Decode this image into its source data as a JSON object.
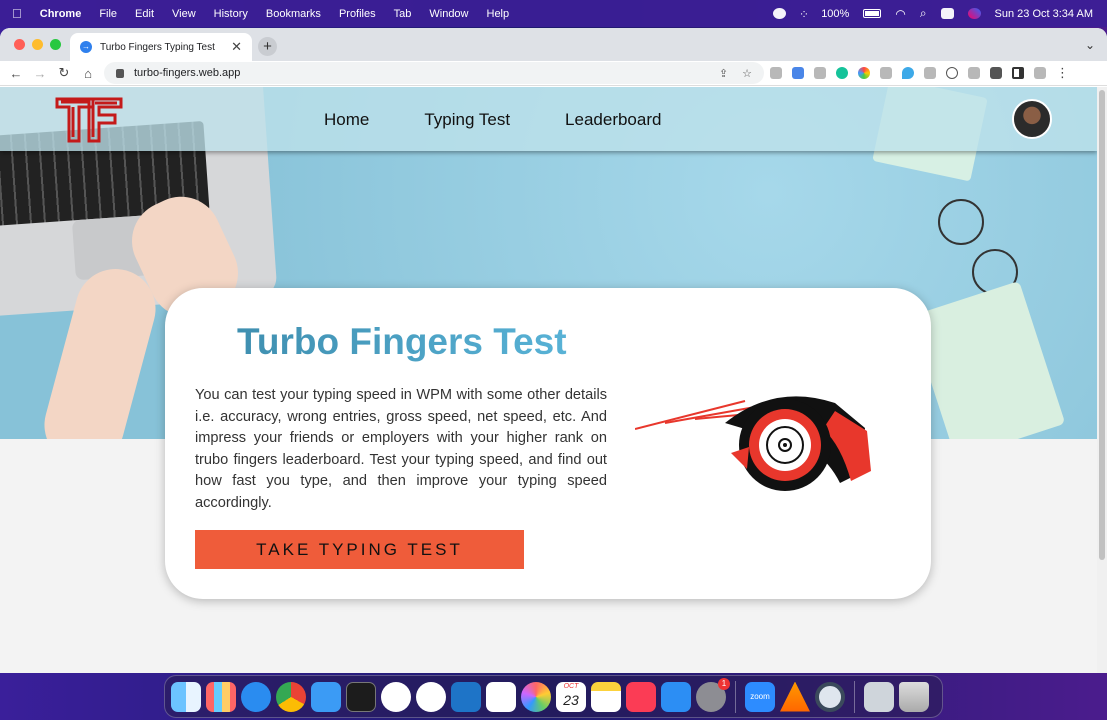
{
  "menubar": {
    "app_name": "Chrome",
    "menus": [
      "File",
      "Edit",
      "View",
      "History",
      "Bookmarks",
      "Profiles",
      "Tab",
      "Window",
      "Help"
    ],
    "battery": "100%",
    "clock": "Sun 23 Oct  3:34 AM"
  },
  "browser": {
    "tab_title": "Turbo Fingers Typing Test",
    "url": "turbo-fingers.web.app"
  },
  "site": {
    "nav": [
      "Home",
      "Typing Test",
      "Leaderboard"
    ],
    "hero_title": "Turbo Fingers Test",
    "description": "You can test your typing speed in WPM with some other details i.e. accuracy, wrong entries, gross speed, net speed, etc. And impress your friends or employers with your higher rank on trubo fingers leaderboard. Test your typing speed, and find out how fast you type, and then improve your typing speed accordingly.",
    "cta_label": "TAKE TYPING TEST",
    "colors": {
      "cta": "#ef5c3a",
      "title_start": "#3f8fb0",
      "title_end": "#58b2d6",
      "logo": "#c41a1a"
    }
  },
  "dock": {
    "calendar_month": "OCT",
    "calendar_day": "23",
    "settings_badge": "1",
    "zoom_label": "zoom"
  }
}
